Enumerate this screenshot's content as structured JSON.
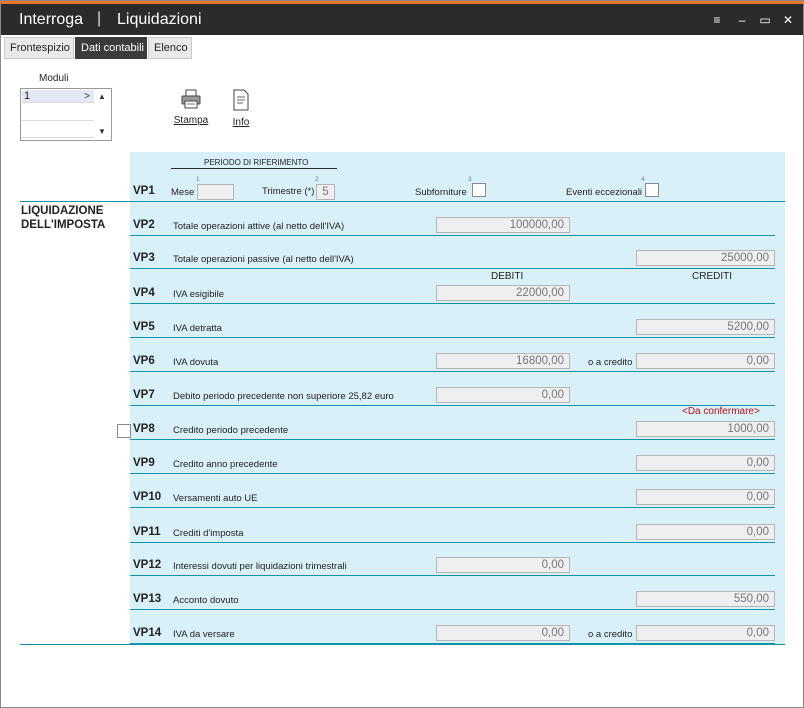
{
  "window": {
    "title_left": "Interroga",
    "separator": "|",
    "title_right": "Liquidazioni",
    "controls": {
      "menu": "≡",
      "minimize": "–",
      "maximize": "▭",
      "close": "✕"
    }
  },
  "tabs": [
    "Frontespizio",
    "Dati contabili",
    "Elenco"
  ],
  "moduli": {
    "label": "Moduli",
    "items": [
      "1"
    ]
  },
  "toolbar": {
    "stampa": "Stampa",
    "info": "Info"
  },
  "section": {
    "title": "LIQUIDAZIONE DELL'IMPOSTA"
  },
  "columns": {
    "debiti": "DEBITI",
    "crediti": "CREDITI"
  },
  "vp1": {
    "code": "VP1",
    "period_heading": "PERIODO DI RIFERIMENTO",
    "mese_label": "Mese",
    "mese_num": "1",
    "mese_value": "",
    "trimestre_label": "Trimestre (*)",
    "trimestre_num": "2",
    "trimestre_value": "5",
    "subforniture_label": "Subforniture",
    "subforniture_num": "3",
    "eventi_label": "Eventi eccezionali",
    "eventi_num": "4"
  },
  "rows": [
    {
      "code": "VP2",
      "desc": "Totale operazioni attive (al netto dell'IVA)",
      "debito": "100000,00"
    },
    {
      "code": "VP3",
      "desc": "Totale operazioni passive (al netto dell'IVA)",
      "credito": "25000,00"
    },
    {
      "code": "VP4",
      "desc": "IVA esigibile",
      "debito": "22000,00"
    },
    {
      "code": "VP5",
      "desc": "IVA detratta",
      "credito": "5200,00"
    },
    {
      "code": "VP6",
      "desc": "IVA dovuta",
      "debito": "16800,00",
      "or_label": "o a credito",
      "credito": "0,00"
    },
    {
      "code": "VP7",
      "desc": "Debito periodo precedente non superiore 25,82 euro",
      "debito": "0,00"
    },
    {
      "code": "VP8",
      "desc": "Credito periodo precedente",
      "note": "<Da confermare>",
      "credito": "1000,00"
    },
    {
      "code": "VP9",
      "desc": "Credito anno precedente",
      "credito": "0,00"
    },
    {
      "code": "VP10",
      "desc": "Versamenti auto UE",
      "credito": "0,00"
    },
    {
      "code": "VP11",
      "desc": "Crediti d'imposta",
      "credito": "0,00"
    },
    {
      "code": "VP12",
      "desc": "Interessi dovuti per liquidazioni trimestrali",
      "debito": "0,00"
    },
    {
      "code": "VP13",
      "desc": "Acconto dovuto",
      "credito": "550,00"
    },
    {
      "code": "VP14",
      "desc": "IVA da versare",
      "debito": "0,00",
      "or_label": "o a credito",
      "credito": "0,00"
    }
  ]
}
